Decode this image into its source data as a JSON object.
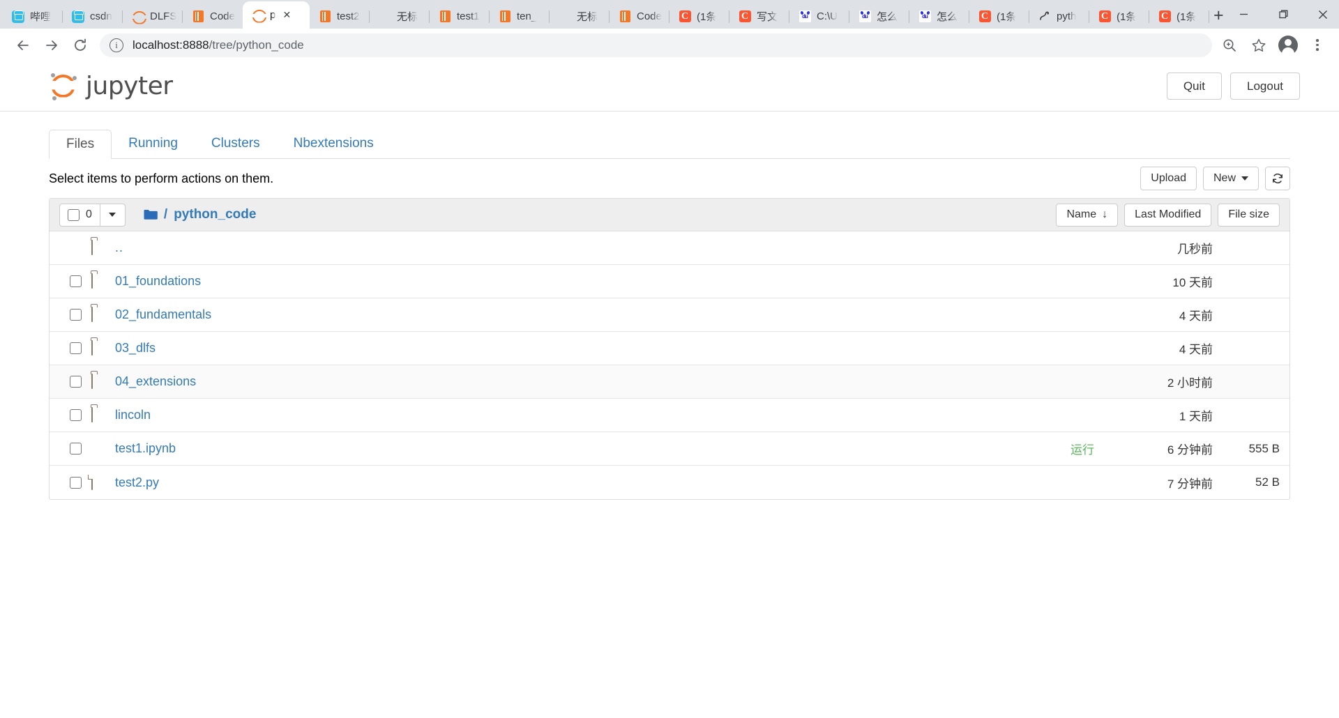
{
  "browser": {
    "tabs": [
      {
        "label": "哔哩",
        "icon": "bilibili-icon",
        "active": false
      },
      {
        "label": "csdn",
        "icon": "bilibili-icon",
        "active": false
      },
      {
        "label": "DLFS",
        "icon": "jupyter-icon",
        "active": false
      },
      {
        "label": "Code",
        "icon": "book-icon",
        "active": false
      },
      {
        "label": "p",
        "icon": "jupyter-icon",
        "active": true
      },
      {
        "label": "test2",
        "icon": "book-icon",
        "active": false
      },
      {
        "label": "无标",
        "icon": "blank-icon",
        "active": false
      },
      {
        "label": "test1",
        "icon": "book-icon",
        "active": false
      },
      {
        "label": "ten_",
        "icon": "book-icon",
        "active": false
      },
      {
        "label": "无标",
        "icon": "blank-icon",
        "active": false
      },
      {
        "label": "Code",
        "icon": "book-icon",
        "active": false
      },
      {
        "label": "(1条",
        "icon": "csdn-icon",
        "active": false
      },
      {
        "label": "写文",
        "icon": "csdn-icon",
        "active": false
      },
      {
        "label": "C:\\U",
        "icon": "baidu-icon",
        "active": false
      },
      {
        "label": "怎么",
        "icon": "baidu-icon",
        "active": false
      },
      {
        "label": "怎么",
        "icon": "baidu-icon",
        "active": false
      },
      {
        "label": "(1条",
        "icon": "csdn-icon",
        "active": false
      },
      {
        "label": "pyth",
        "icon": "python-icon",
        "active": false
      },
      {
        "label": "(1条",
        "icon": "csdn-icon",
        "active": false
      },
      {
        "label": "(1条",
        "icon": "csdn-icon",
        "active": false
      }
    ],
    "new_tab_label": "+",
    "window_controls": {
      "minimize": "—",
      "maximize": "❐",
      "close": "✕"
    },
    "toolbar": {
      "back": "←",
      "forward": "→",
      "reload": "⟳",
      "url_host": "localhost:8888",
      "url_path": "/tree/python_code",
      "info_icon": "ⓘ",
      "zoom_icon": "zoom-icon",
      "bookmark_icon": "star-icon",
      "profile_icon": "avatar-icon",
      "menu_icon": "kebab-menu-icon"
    }
  },
  "jupyter": {
    "logo_text": "jupyter",
    "quit_label": "Quit",
    "logout_label": "Logout",
    "nav_tabs": [
      {
        "label": "Files",
        "active": true
      },
      {
        "label": "Running",
        "active": false
      },
      {
        "label": "Clusters",
        "active": false
      },
      {
        "label": "Nbextensions",
        "active": false
      }
    ],
    "action_text": "Select items to perform actions on them.",
    "upload_label": "Upload",
    "new_label": "New",
    "refresh_icon": "refresh-icon",
    "breadcrumb": {
      "selected_count": "0",
      "root_icon": "folder-icon",
      "separator": "/",
      "path": "python_code"
    },
    "sort_buttons": [
      {
        "label": "Name",
        "arrow": "↓"
      },
      {
        "label": "Last Modified",
        "arrow": ""
      },
      {
        "label": "File size",
        "arrow": ""
      }
    ],
    "files": [
      {
        "name": "..",
        "icon": "folder-icon",
        "checkbox": false,
        "running": "",
        "modified": "几秒前",
        "size": "",
        "alt": false
      },
      {
        "name": "01_foundations",
        "icon": "folder-icon",
        "checkbox": true,
        "running": "",
        "modified": "10 天前",
        "size": "",
        "alt": false
      },
      {
        "name": "02_fundamentals",
        "icon": "folder-icon",
        "checkbox": true,
        "running": "",
        "modified": "4 天前",
        "size": "",
        "alt": false
      },
      {
        "name": "03_dlfs",
        "icon": "folder-icon",
        "checkbox": true,
        "running": "",
        "modified": "4 天前",
        "size": "",
        "alt": false
      },
      {
        "name": "04_extensions",
        "icon": "folder-icon",
        "checkbox": true,
        "running": "",
        "modified": "2 小时前",
        "size": "",
        "alt": true
      },
      {
        "name": "lincoln",
        "icon": "folder-icon",
        "checkbox": true,
        "running": "",
        "modified": "1 天前",
        "size": "",
        "alt": false
      },
      {
        "name": "test1.ipynb",
        "icon": "notebook-icon",
        "checkbox": true,
        "running": "运行",
        "modified": "6 分钟前",
        "size": "555 B",
        "alt": false
      },
      {
        "name": "test2.py",
        "icon": "file-icon",
        "checkbox": true,
        "running": "",
        "modified": "7 分钟前",
        "size": "52 B",
        "alt": false
      }
    ]
  }
}
